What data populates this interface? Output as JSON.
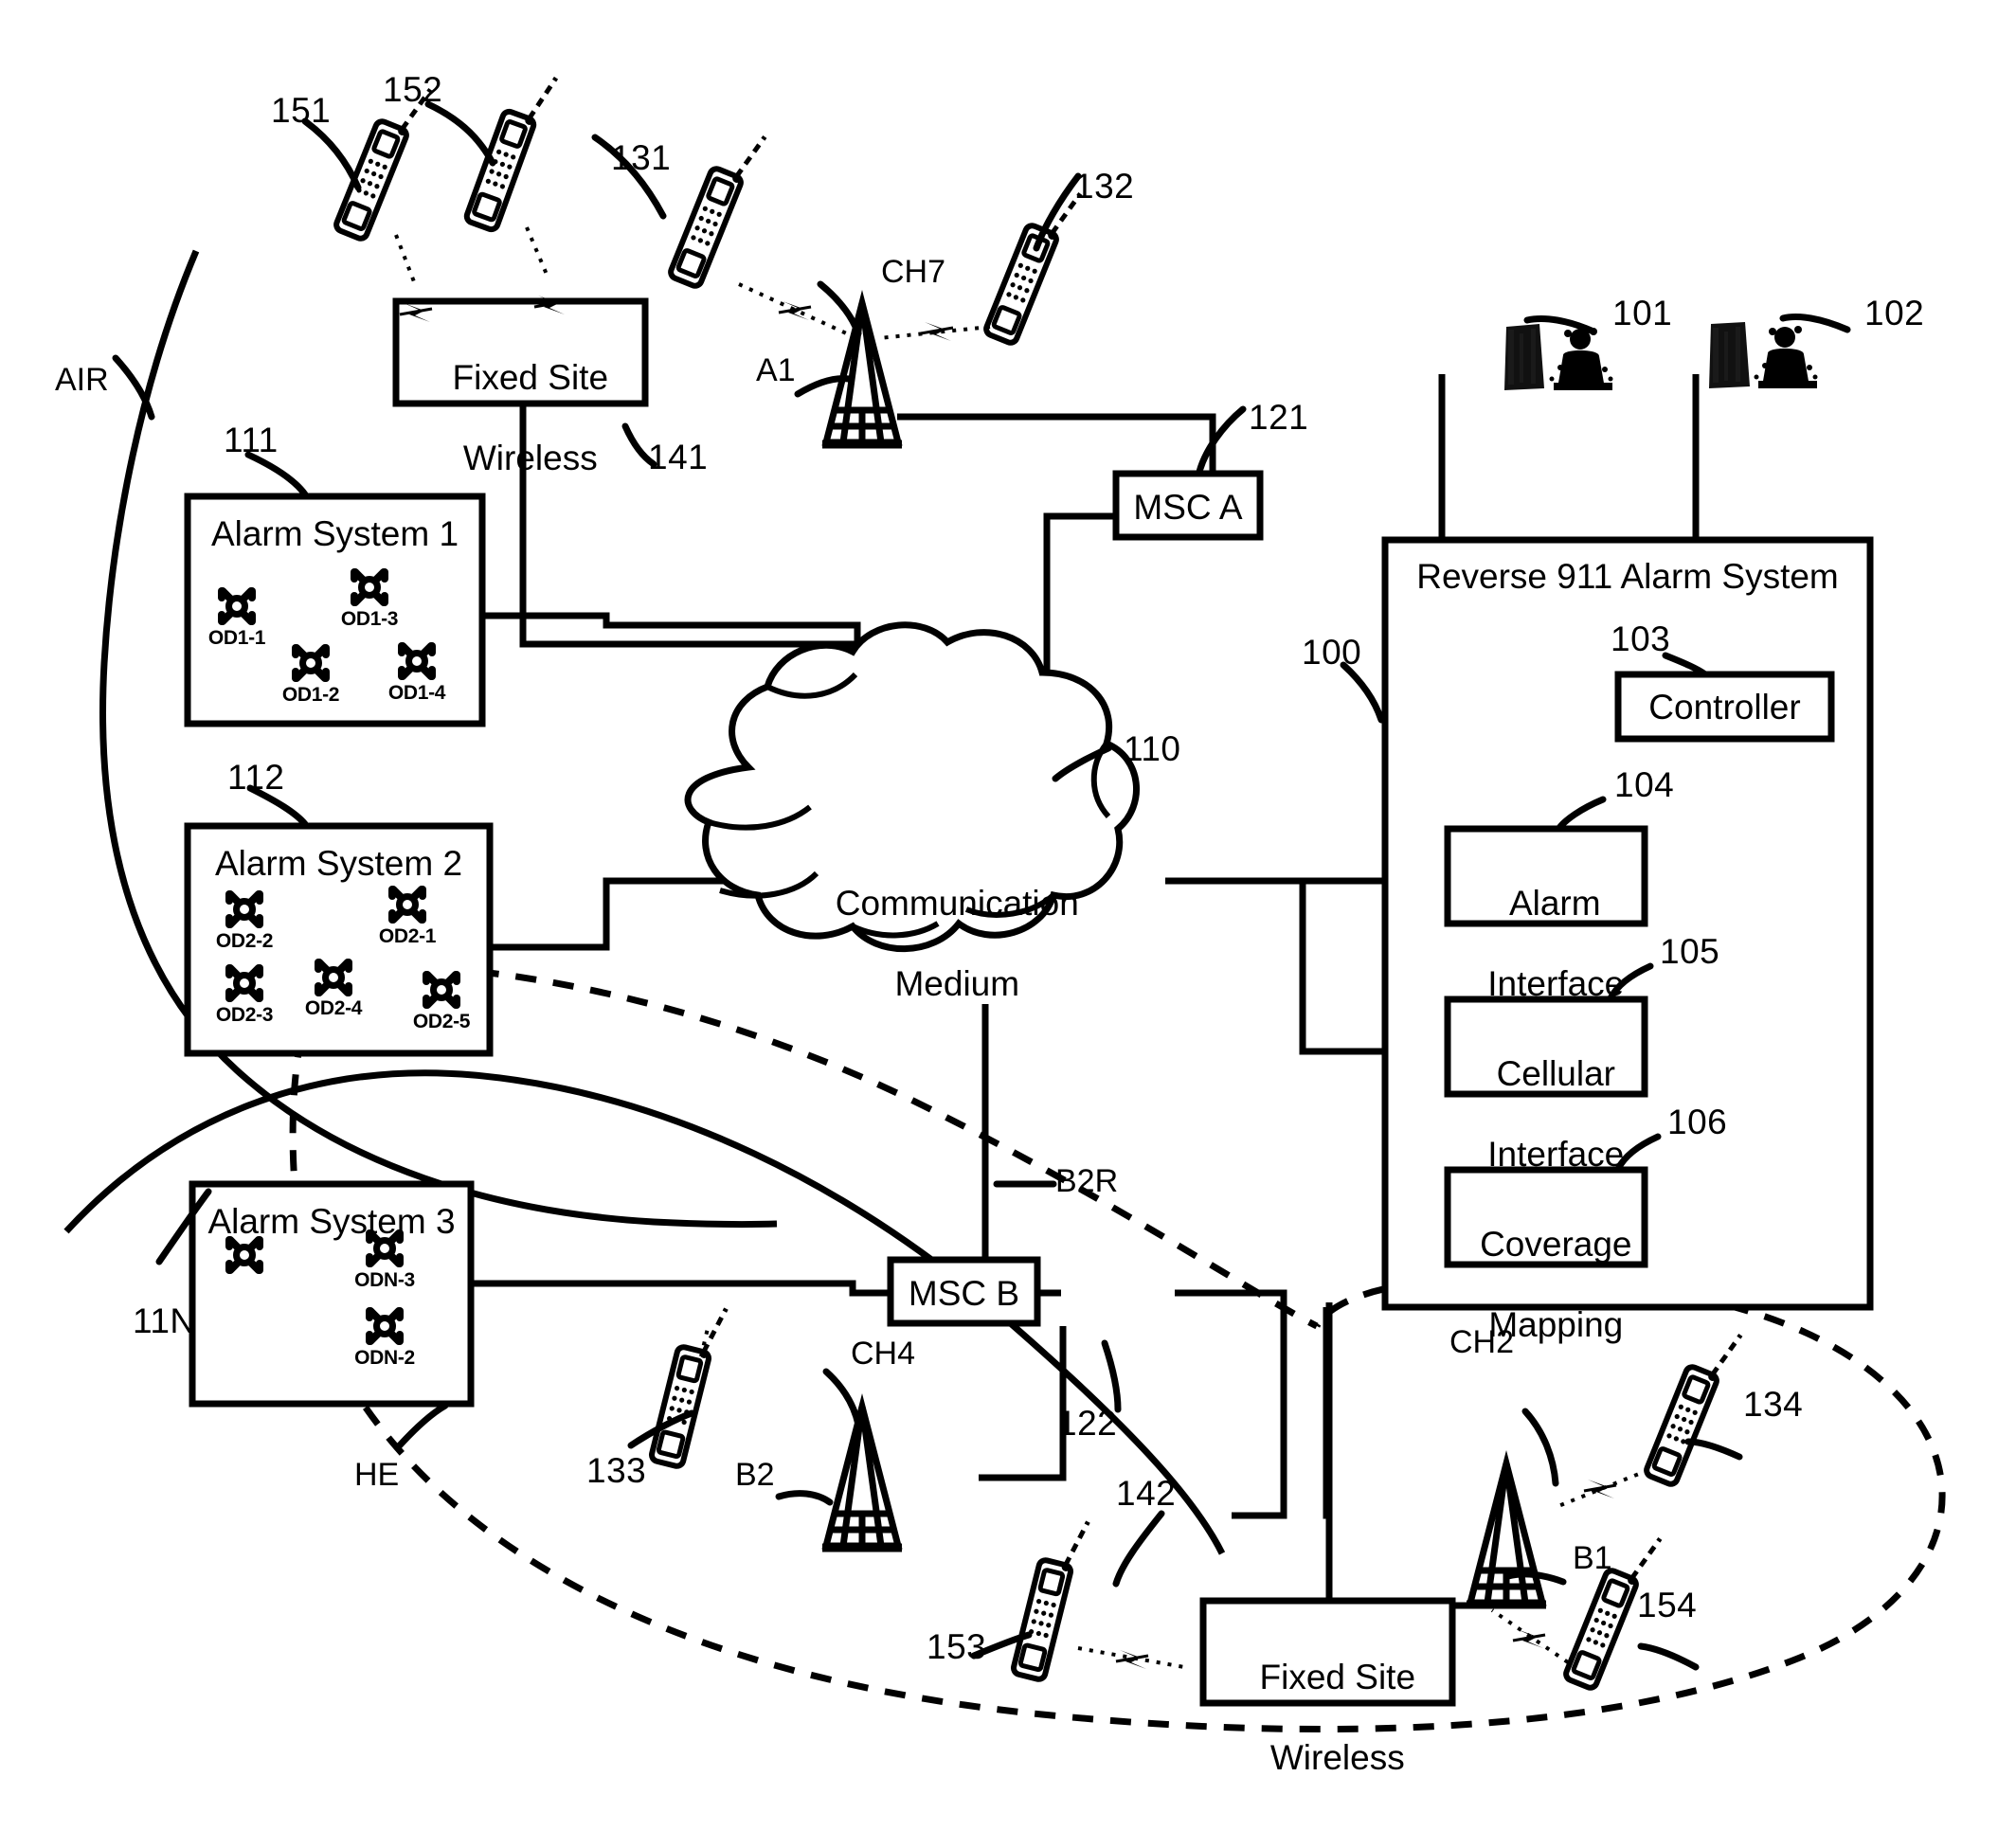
{
  "figure": {
    "title": "Reverse 911 Alarm System network diagram",
    "stroke_color": "#000000",
    "background_color": "#ffffff"
  },
  "boxes": {
    "fixed_site_wireless_top": {
      "line1": "Fixed Site",
      "line2": "Wireless",
      "ref": "141"
    },
    "fixed_site_wireless_bottom": {
      "line1": "Fixed Site",
      "line2": "Wireless",
      "ref": "142"
    },
    "msc_a": {
      "label": "MSC A",
      "ref": "121"
    },
    "msc_b": {
      "label": "MSC B",
      "ref": "122"
    },
    "reverse911": {
      "label": "Reverse 911 Alarm System",
      "ref": "100"
    },
    "controller": {
      "label": "Controller",
      "ref": "103"
    },
    "alarm_interface": {
      "line1": "Alarm",
      "line2": "Interface",
      "ref": "104"
    },
    "cellular_interface": {
      "line1": "Cellular",
      "line2": "Interface",
      "ref": "105"
    },
    "coverage_mapping": {
      "line1": "Coverage",
      "line2": "Mapping",
      "ref": "106"
    },
    "cloud": {
      "line1": "Communication",
      "line2": "Medium",
      "ref": "110"
    }
  },
  "alarm_systems": [
    {
      "name": "Alarm System 1",
      "ref": "111",
      "detectors": [
        {
          "id": "OD1-1"
        },
        {
          "id": "OD1-3"
        },
        {
          "id": "OD1-2"
        },
        {
          "id": "OD1-4"
        }
      ]
    },
    {
      "name": "Alarm System 2",
      "ref": "112",
      "detectors": [
        {
          "id": "OD2-2"
        },
        {
          "id": "OD2-1"
        },
        {
          "id": "OD2-3"
        },
        {
          "id": "OD2-4"
        },
        {
          "id": "OD2-5"
        }
      ]
    },
    {
      "name": "Alarm System 3",
      "ref": "11N",
      "detectors": [
        {
          "id": ""
        },
        {
          "id": "ODN-3"
        },
        {
          "id": "ODN-2"
        }
      ]
    }
  ],
  "towers": [
    {
      "id": "A1",
      "channel": "CH7"
    },
    {
      "id": "B2",
      "channel": "CH4"
    },
    {
      "id": "B1",
      "channel": "CH2"
    }
  ],
  "handsets": [
    {
      "ref": "151"
    },
    {
      "ref": "152"
    },
    {
      "ref": "131"
    },
    {
      "ref": "132"
    },
    {
      "ref": "133"
    },
    {
      "ref": "134"
    },
    {
      "ref": "153"
    },
    {
      "ref": "154"
    }
  ],
  "operators": [
    {
      "ref": "101"
    },
    {
      "ref": "102"
    }
  ],
  "region_labels": [
    {
      "text": "AIR"
    },
    {
      "text": "HE"
    },
    {
      "text": "B2R"
    }
  ]
}
